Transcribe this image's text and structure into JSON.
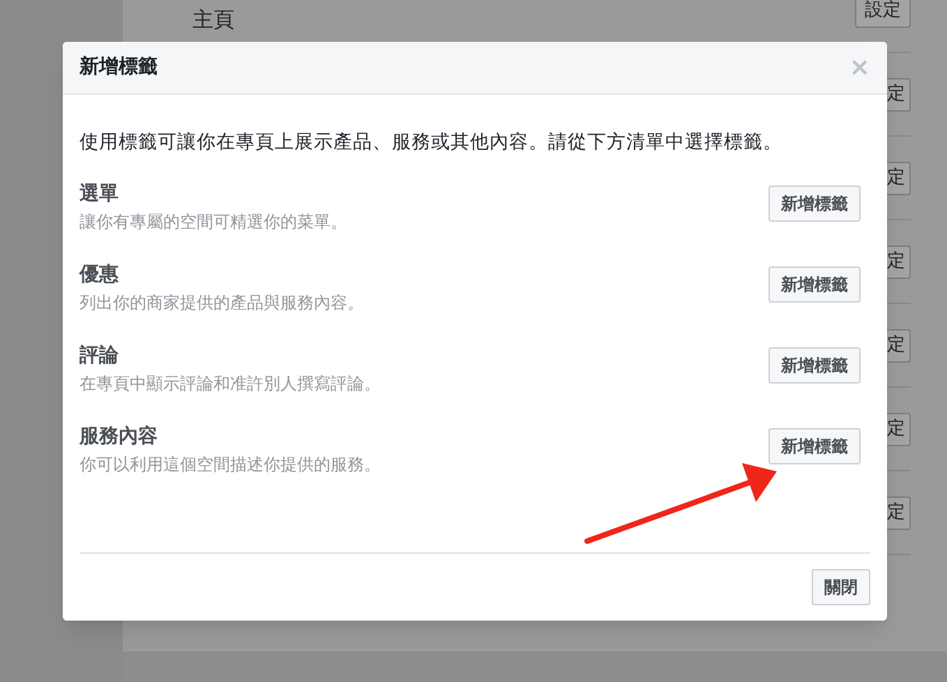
{
  "background": {
    "rows": [
      {
        "label": "主頁",
        "button": "設定"
      },
      {
        "button": "定"
      },
      {
        "button": "定"
      },
      {
        "button": "定"
      },
      {
        "button": "定"
      },
      {
        "button": "定"
      },
      {
        "button": "定"
      }
    ]
  },
  "dialog": {
    "title": "新增標籤",
    "close_icon": "×",
    "intro": "使用標籤可讓你在專頁上展示產品、服務或其他內容。請從下方清單中選擇標籤。",
    "tabs": [
      {
        "name": "選單",
        "description": "讓你有專屬的空間可精選你的菜單。",
        "button": "新增標籤"
      },
      {
        "name": "優惠",
        "description": "列出你的商家提供的產品與服務內容。",
        "button": "新增標籤"
      },
      {
        "name": "評論",
        "description": "在專頁中顯示評論和准許別人撰寫評論。",
        "button": "新增標籤"
      },
      {
        "name": "服務內容",
        "description": "你可以利用這個空間描述你提供的服務。",
        "button": "新增標籤"
      }
    ],
    "close_button": "關閉"
  }
}
